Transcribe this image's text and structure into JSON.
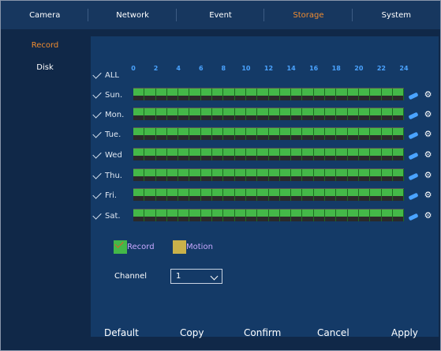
{
  "tabs": [
    {
      "label": "Camera",
      "active": false
    },
    {
      "label": "Network",
      "active": false
    },
    {
      "label": "Event",
      "active": false
    },
    {
      "label": "Storage",
      "active": true
    },
    {
      "label": "System",
      "active": false
    }
  ],
  "sidebar": [
    {
      "label": "Record",
      "active": true
    },
    {
      "label": "Disk",
      "active": false
    }
  ],
  "schedule": {
    "all_label": "ALL",
    "hours": [
      "0",
      "2",
      "4",
      "6",
      "8",
      "10",
      "12",
      "14",
      "16",
      "18",
      "20",
      "22",
      "24"
    ],
    "days": [
      {
        "label": "Sun.",
        "record_fraction": 1.0
      },
      {
        "label": "Mon.",
        "record_fraction": 1.0
      },
      {
        "label": "Tue.",
        "record_fraction": 1.0
      },
      {
        "label": "Wed",
        "record_fraction": 1.0
      },
      {
        "label": "Thu.",
        "record_fraction": 1.0
      },
      {
        "label": "Fri.",
        "record_fraction": 1.0
      },
      {
        "label": "Sat.",
        "record_fraction": 1.0
      }
    ]
  },
  "legend": {
    "record": {
      "label": "Record",
      "color": "#44b848"
    },
    "motion": {
      "label": "Motion",
      "color": "#c9b14a"
    }
  },
  "channel": {
    "label": "Channel",
    "value": "1"
  },
  "footer": {
    "default": "Default",
    "copy": "Copy",
    "confirm": "Confirm",
    "cancel": "Cancel",
    "apply": "Apply"
  },
  "colors": {
    "accent": "#f08c30",
    "hour_label": "#4aa3ff"
  }
}
